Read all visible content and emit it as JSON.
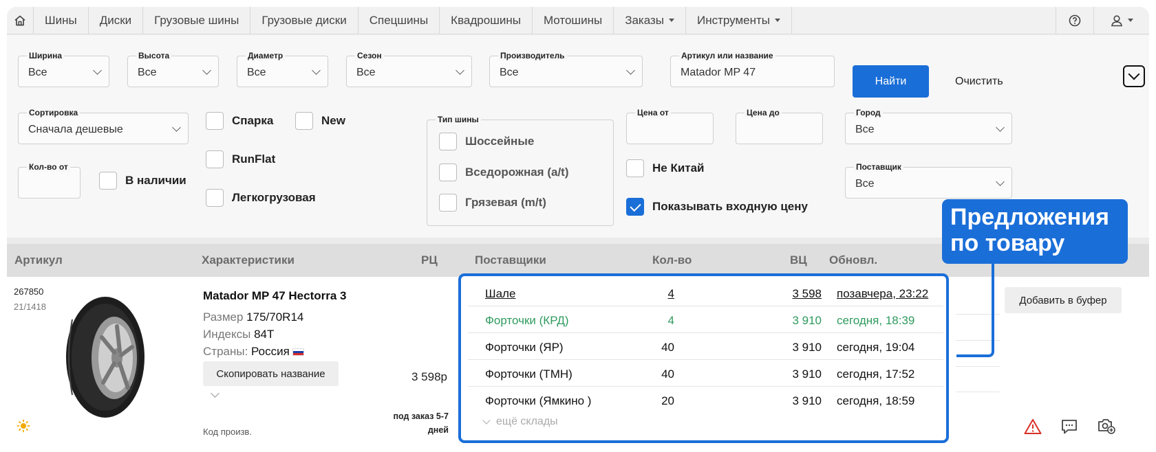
{
  "nav": {
    "items": [
      "Шины",
      "Диски",
      "Грузовые шины",
      "Грузовые диски",
      "Спецшины",
      "Квадрошины",
      "Мотошины"
    ],
    "orders": "Заказы",
    "tools": "Инструменты"
  },
  "filters": {
    "width": {
      "label": "Ширина",
      "value": "Все"
    },
    "height": {
      "label": "Высота",
      "value": "Все"
    },
    "diameter": {
      "label": "Диаметр",
      "value": "Все"
    },
    "season": {
      "label": "Сезон",
      "value": "Все"
    },
    "manufacturer": {
      "label": "Производитель",
      "value": "Все"
    },
    "article": {
      "label": "Артикул или название",
      "value": "Matador MP 47"
    },
    "find_button": "Найти",
    "clear_button": "Очистить",
    "sort": {
      "label": "Сортировка",
      "value": "Сначала дешевые"
    },
    "qty_from": {
      "label": "Кол-во от",
      "value": ""
    },
    "in_stock": "В наличии",
    "spark": "Спарка",
    "new": "New",
    "runflat": "RunFlat",
    "light_truck": "Легкогрузовая",
    "tire_type": {
      "label": "Тип шины",
      "options": [
        "Шоссейные",
        "Вседорожная (a/t)",
        "Грязевая (m/t)"
      ]
    },
    "price_from": {
      "label": "Цена от",
      "value": ""
    },
    "price_to": {
      "label": "Цена до",
      "value": ""
    },
    "city": {
      "label": "Город",
      "value": "Все"
    },
    "supplier": {
      "label": "Поставщик",
      "value": "Все"
    },
    "not_china": "Не Китай",
    "show_in_price": {
      "label": "Показывать входную цену",
      "checked": true
    }
  },
  "table": {
    "headers": {
      "article": "Артикул",
      "specs": "Характеристики",
      "rrp": "РЦ",
      "suppliers": "Поставщики",
      "qty": "Кол-во",
      "in_price": "ВЦ",
      "updated": "Обновл."
    }
  },
  "product": {
    "article": "267850",
    "article_sub": "21/1418",
    "name": "Matador MP 47 Hectorra 3",
    "size_label": "Размер",
    "size": "175/70R14",
    "index_label": "Индексы",
    "index": "84T",
    "country_label": "Страны:",
    "country": "Россия",
    "copy_button": "Скопировать название",
    "code_label": "Код произв.",
    "price": "3 598р",
    "order_note": "под заказ 5-7 дней",
    "season_icon": "sun-icon"
  },
  "suppliers": [
    {
      "name": "Шале",
      "qty": "4",
      "price": "3 598",
      "updated": "позавчера, 23:22",
      "style": "link"
    },
    {
      "name": "Форточки (КРД)",
      "qty": "4",
      "price": "3 910",
      "updated": "сегодня, 18:39",
      "style": "green"
    },
    {
      "name": "Форточки (ЯР)",
      "qty": "40",
      "price": "3 910",
      "updated": "сегодня, 19:04",
      "style": "normal"
    },
    {
      "name": "Форточки (ТМН)",
      "qty": "40",
      "price": "3 910",
      "updated": "сегодня, 17:52",
      "style": "normal"
    },
    {
      "name": "Форточки (Ямкино )",
      "qty": "20",
      "price": "3 910",
      "updated": "сегодня, 18:59",
      "style": "normal"
    }
  ],
  "more_warehouses": "ещё склады",
  "add_to_buffer": "Добавить в буфер",
  "callout": {
    "line1": "Предложения",
    "line2": "по товару"
  },
  "colors": {
    "accent": "#1a6ed8",
    "green": "#2f9a5e",
    "warning": "#d93025"
  }
}
